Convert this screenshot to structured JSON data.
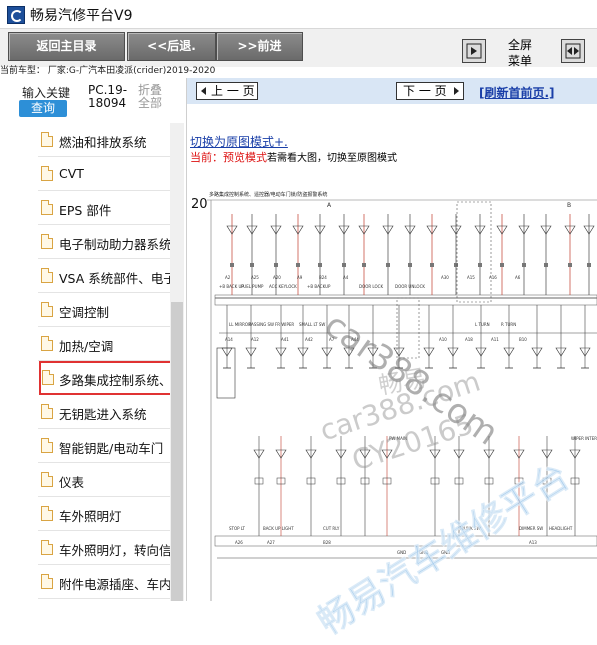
{
  "app": {
    "title": "畅易汽修平台V9",
    "icon": "app-logo-icon"
  },
  "toolbar": {
    "home_label": "返回主目录",
    "back_label": "<<后退.",
    "forward_label": ">>前进",
    "fullscreen_label_1": "全屏",
    "fullscreen_label_2": "菜单"
  },
  "vehicle_line": "当前车型： 厂家:G-广汽本田凌派(crider)2019-2020",
  "left": {
    "tab_input": "输入关键",
    "query_label": "查询",
    "tab_pc_1": "PC.19-",
    "tab_pc_2": "18094",
    "tab_fold_1": "折叠",
    "tab_fold_2": "全部",
    "tree": [
      "燃油和排放系统",
      "CVT",
      "EPS 部件",
      "电子制动助力器系统",
      "VSA 系统部件、电子",
      "空调控制",
      "加热/空调",
      "多路集成控制系统、",
      "无钥匙进入系统",
      "智能钥匙/电动车门",
      "仪表",
      "车外照明灯",
      "车外照明灯，转向信",
      "附件电源插座、车内"
    ],
    "selected_index": 7
  },
  "right": {
    "prev_label": "上 一 页",
    "next_label": "下 一 页",
    "refresh_label": "[刷新首前页.]",
    "mode_link": "切换为原图模式+.",
    "hint_prefix": "当前：",
    "hint_mode": "预览模式",
    "hint_suffix": "若需看大图，切换至原图模式"
  },
  "diagram": {
    "page_no": "20",
    "title": "多路集成控制系统、遥控器/电动车门锁/防盗报警系统",
    "col_a": "A",
    "col_b": "B",
    "labels": [
      "+B BACK UP",
      "FUEL PUMP",
      "ACC KEYLOCK",
      "+B BACKUP",
      "DOOR LOCK",
      "DOOR UNLOCK",
      "LL MIRROR",
      "PASSING SW",
      "FR WIPER",
      "SMALL LT SW",
      "L TURN",
      "R TURN",
      "STOP LT",
      "BACK UP LIGHT",
      "CUT RLY",
      "TRUNK SW",
      "DIMMER SW",
      "HEADLIGHT",
      "WIPER INTERMITTENT",
      "PW MAIN"
    ],
    "connectors": [
      "A2",
      "A25",
      "A20",
      "A9",
      "B24",
      "A4",
      "A30",
      "A15",
      "A16",
      "A6",
      "A14",
      "A12",
      "A41",
      "A42",
      "A7",
      "A44",
      "A10",
      "A18",
      "A11",
      "B10",
      "A26",
      "A27",
      "B28",
      "A13"
    ],
    "ground_labels": [
      "GND",
      "GND",
      "GND"
    ]
  },
  "watermarks": [
    "car388.com",
    "畅易",
    "car388.com",
    "CY20165",
    "畅易汽车维修平台"
  ],
  "colors": {
    "accent": "#2d8fd7",
    "link": "#1a3fa8",
    "highlight": "#e03232",
    "nav_bg": "#d9e6f5"
  }
}
